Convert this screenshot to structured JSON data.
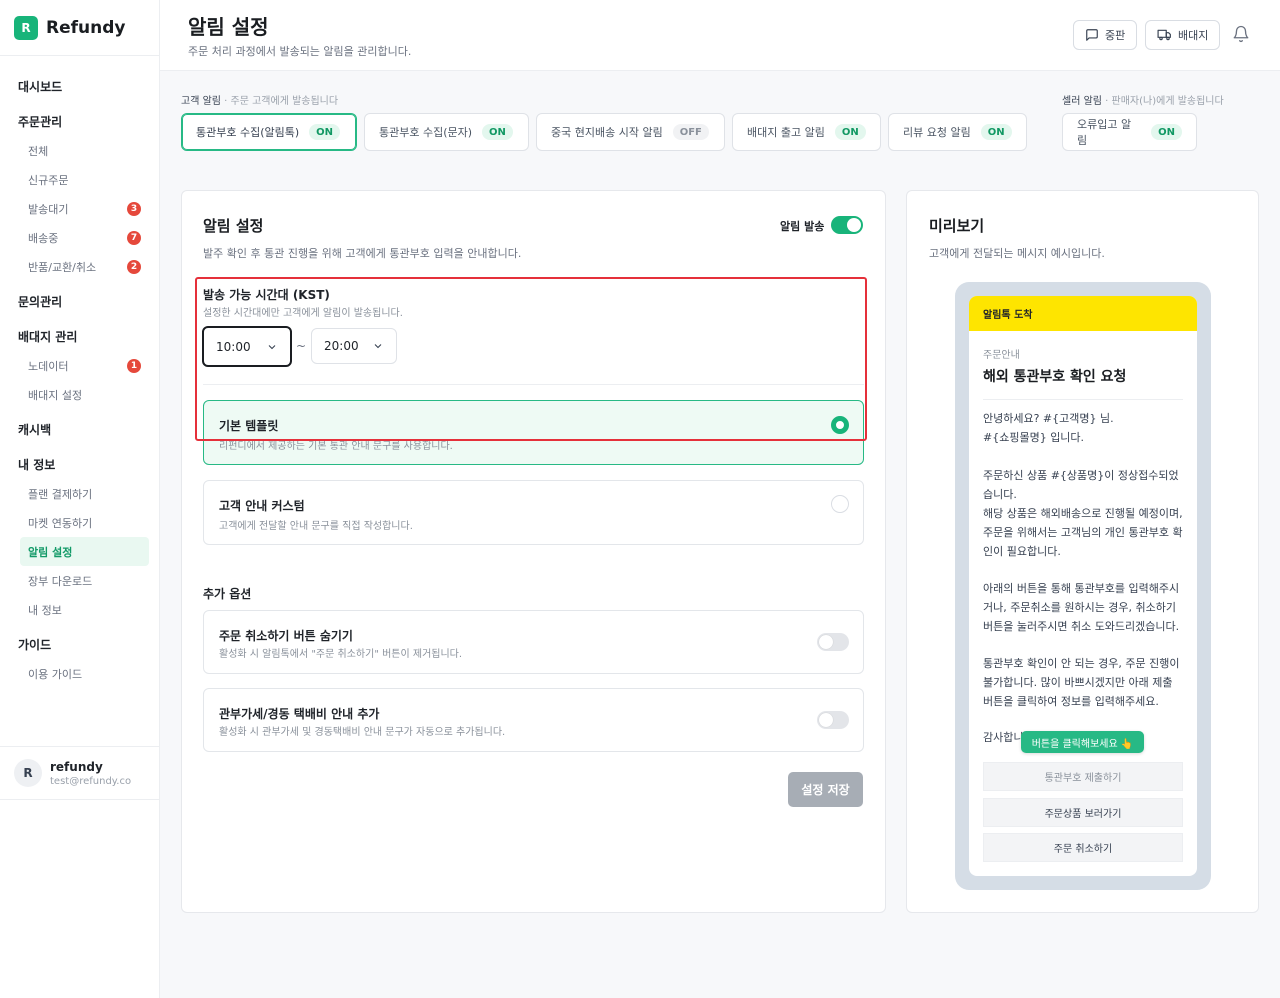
{
  "brand": {
    "logo_letter": "R",
    "name": "Refundy"
  },
  "sidebar": {
    "sections": [
      {
        "label": "대시보드",
        "items": []
      },
      {
        "label": "주문관리",
        "items": [
          {
            "label": "전체"
          },
          {
            "label": "신규주문"
          },
          {
            "label": "발송대기",
            "badge": "3"
          },
          {
            "label": "배송중",
            "badge": "7"
          },
          {
            "label": "반품/교환/취소",
            "badge": "2"
          }
        ]
      },
      {
        "label": "문의관리",
        "items": []
      },
      {
        "label": "배대지 관리",
        "items": [
          {
            "label": "노데이터",
            "badge": "1"
          },
          {
            "label": "배대지 설정"
          }
        ]
      },
      {
        "label": "캐시백",
        "items": []
      },
      {
        "label": "내 정보",
        "items": [
          {
            "label": "플랜 결제하기"
          },
          {
            "label": "마켓 연동하기"
          },
          {
            "label": "알림 설정",
            "active": true
          },
          {
            "label": "장부 다운로드"
          },
          {
            "label": "내 정보"
          }
        ]
      },
      {
        "label": "가이드",
        "items": [
          {
            "label": "이용 가이드"
          }
        ]
      }
    ],
    "user": {
      "initial": "R",
      "name": "refundy",
      "email": "test@refundy.co"
    }
  },
  "header": {
    "title": "알림 설정",
    "subtitle": "주문 처리 과정에서 발송되는 알림을 관리합니다.",
    "buttons": [
      {
        "label": "중판",
        "icon": "message-square-icon"
      },
      {
        "label": "배대지",
        "icon": "truck-icon"
      }
    ]
  },
  "tabs": {
    "customer_label": "고객 알림",
    "customer_note": "· 주문 고객에게 발송됩니다",
    "seller_label": "셀러 알림",
    "seller_note": "· 판매자(나)에게 발송됩니다",
    "items": [
      {
        "label": "통관부호 수집(알림톡)",
        "status": "ON",
        "active": true
      },
      {
        "label": "통관부호 수집(문자)",
        "status": "ON"
      },
      {
        "label": "중국 현지배송 시작 알림",
        "status": "OFF"
      },
      {
        "label": "배대지 출고 알림",
        "status": "ON"
      },
      {
        "label": "리뷰 요청 알림",
        "status": "ON"
      },
      {
        "label": "오류입고 알림",
        "status": "ON"
      }
    ]
  },
  "settings": {
    "title": "알림 설정",
    "desc": "발주 확인 후 통관 진행을 위해 고객에게 통관부호 입력을 안내합니다.",
    "toggle_label": "알림 발송",
    "time": {
      "title": "발송 가능 시간대 (KST)",
      "desc": "설정한 시간대에만 고객에게 알림이 발송됩니다.",
      "start": "10:00",
      "sep": "~",
      "end": "20:00"
    },
    "templates": [
      {
        "title": "기본 템플릿",
        "desc": "리펀디에서 제공하는 기본 통관 안내 문구를 사용합니다.",
        "selected": true
      },
      {
        "title": "고객 안내 커스텀",
        "desc": "고객에게 전달할 안내 문구를 직접 작성합니다."
      }
    ],
    "extra_title": "추가 옵션",
    "extras": [
      {
        "title": "주문 취소하기 버튼 숨기기",
        "desc": "활성화 시 알림톡에서 \"주문 취소하기\" 버튼이 제거됩니다."
      },
      {
        "title": "관부가세/경동 택배비 안내 추가",
        "desc": "활성화 시 관부가세 및 경동택배비 안내 문구가 자동으로 추가됩니다."
      }
    ],
    "save_label": "설정 저장"
  },
  "preview": {
    "title": "미리보기",
    "desc": "고객에게 전달되는 메시지 예시입니다.",
    "head": "알림톡 도착",
    "category": "주문안내",
    "msg_title": "해외 통관부호 확인 요청",
    "p1": "안녕하세요? #{고객명} 님.\n#{쇼핑몰명} 입니다.",
    "p2": "주문하신 상품 #{상품명}이 정상접수되었습니다.\n해당 상품은 해외배송으로 진행될 예정이며, 주문을 위해서는 고객님의 개인 통관부호 확인이 필요합니다.",
    "p3": "아래의 버튼을 통해 통관부호를 입력해주시거나, 주문취소를 원하시는 경우, 취소하기 버튼을 눌러주시면 취소 도와드리겠습니다.",
    "p4": "통관부호 확인이 안 되는 경우, 주문 진행이 불가합니다. 많이 바쁘시겠지만 아래 제출 버튼을 클릭하여 정보를 입력해주세요.",
    "p5": "감사합니다.",
    "tooltip": "버튼을 클릭해보세요 👆",
    "buttons": [
      "통관부호 제출하기",
      "주문상품 보러가기",
      "주문 취소하기"
    ]
  },
  "colors": {
    "accent": "#18b47a",
    "kakao": "#fee500",
    "highlight": "#e5303a"
  }
}
